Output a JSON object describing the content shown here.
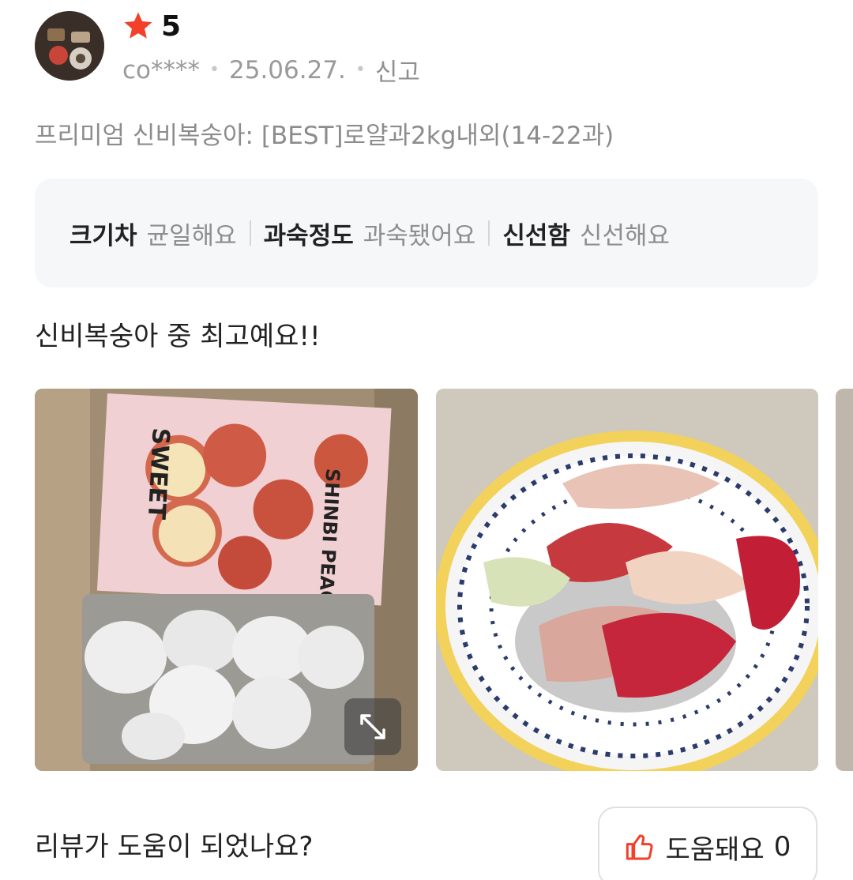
{
  "review": {
    "rating": "5",
    "author": "co****",
    "date": "25.06.27.",
    "report_label": "신고",
    "option": "프리미엄 신비복숭아: [BEST]로얄과2kg내외(14-22과)",
    "attributes": [
      {
        "key": "크기차",
        "value": "균일해요"
      },
      {
        "key": "과숙정도",
        "value": "과숙됐어요"
      },
      {
        "key": "신선함",
        "value": "신선해요"
      }
    ],
    "text": "신비복숭아 중 최고예요!!",
    "photos": [
      {
        "label": "SWEET",
        "label2": "SHINBI PEACH"
      },
      {
        "label": ""
      }
    ]
  },
  "helpful": {
    "question": "리뷰가 도움이 되었나요?",
    "button_label": "도움돼요",
    "count": "0"
  },
  "colors": {
    "star": "#f2402a",
    "thumb": "#f2402a"
  },
  "icons": {
    "star": "star-icon",
    "expand": "expand-icon",
    "thumb": "thumbs-up-icon"
  }
}
